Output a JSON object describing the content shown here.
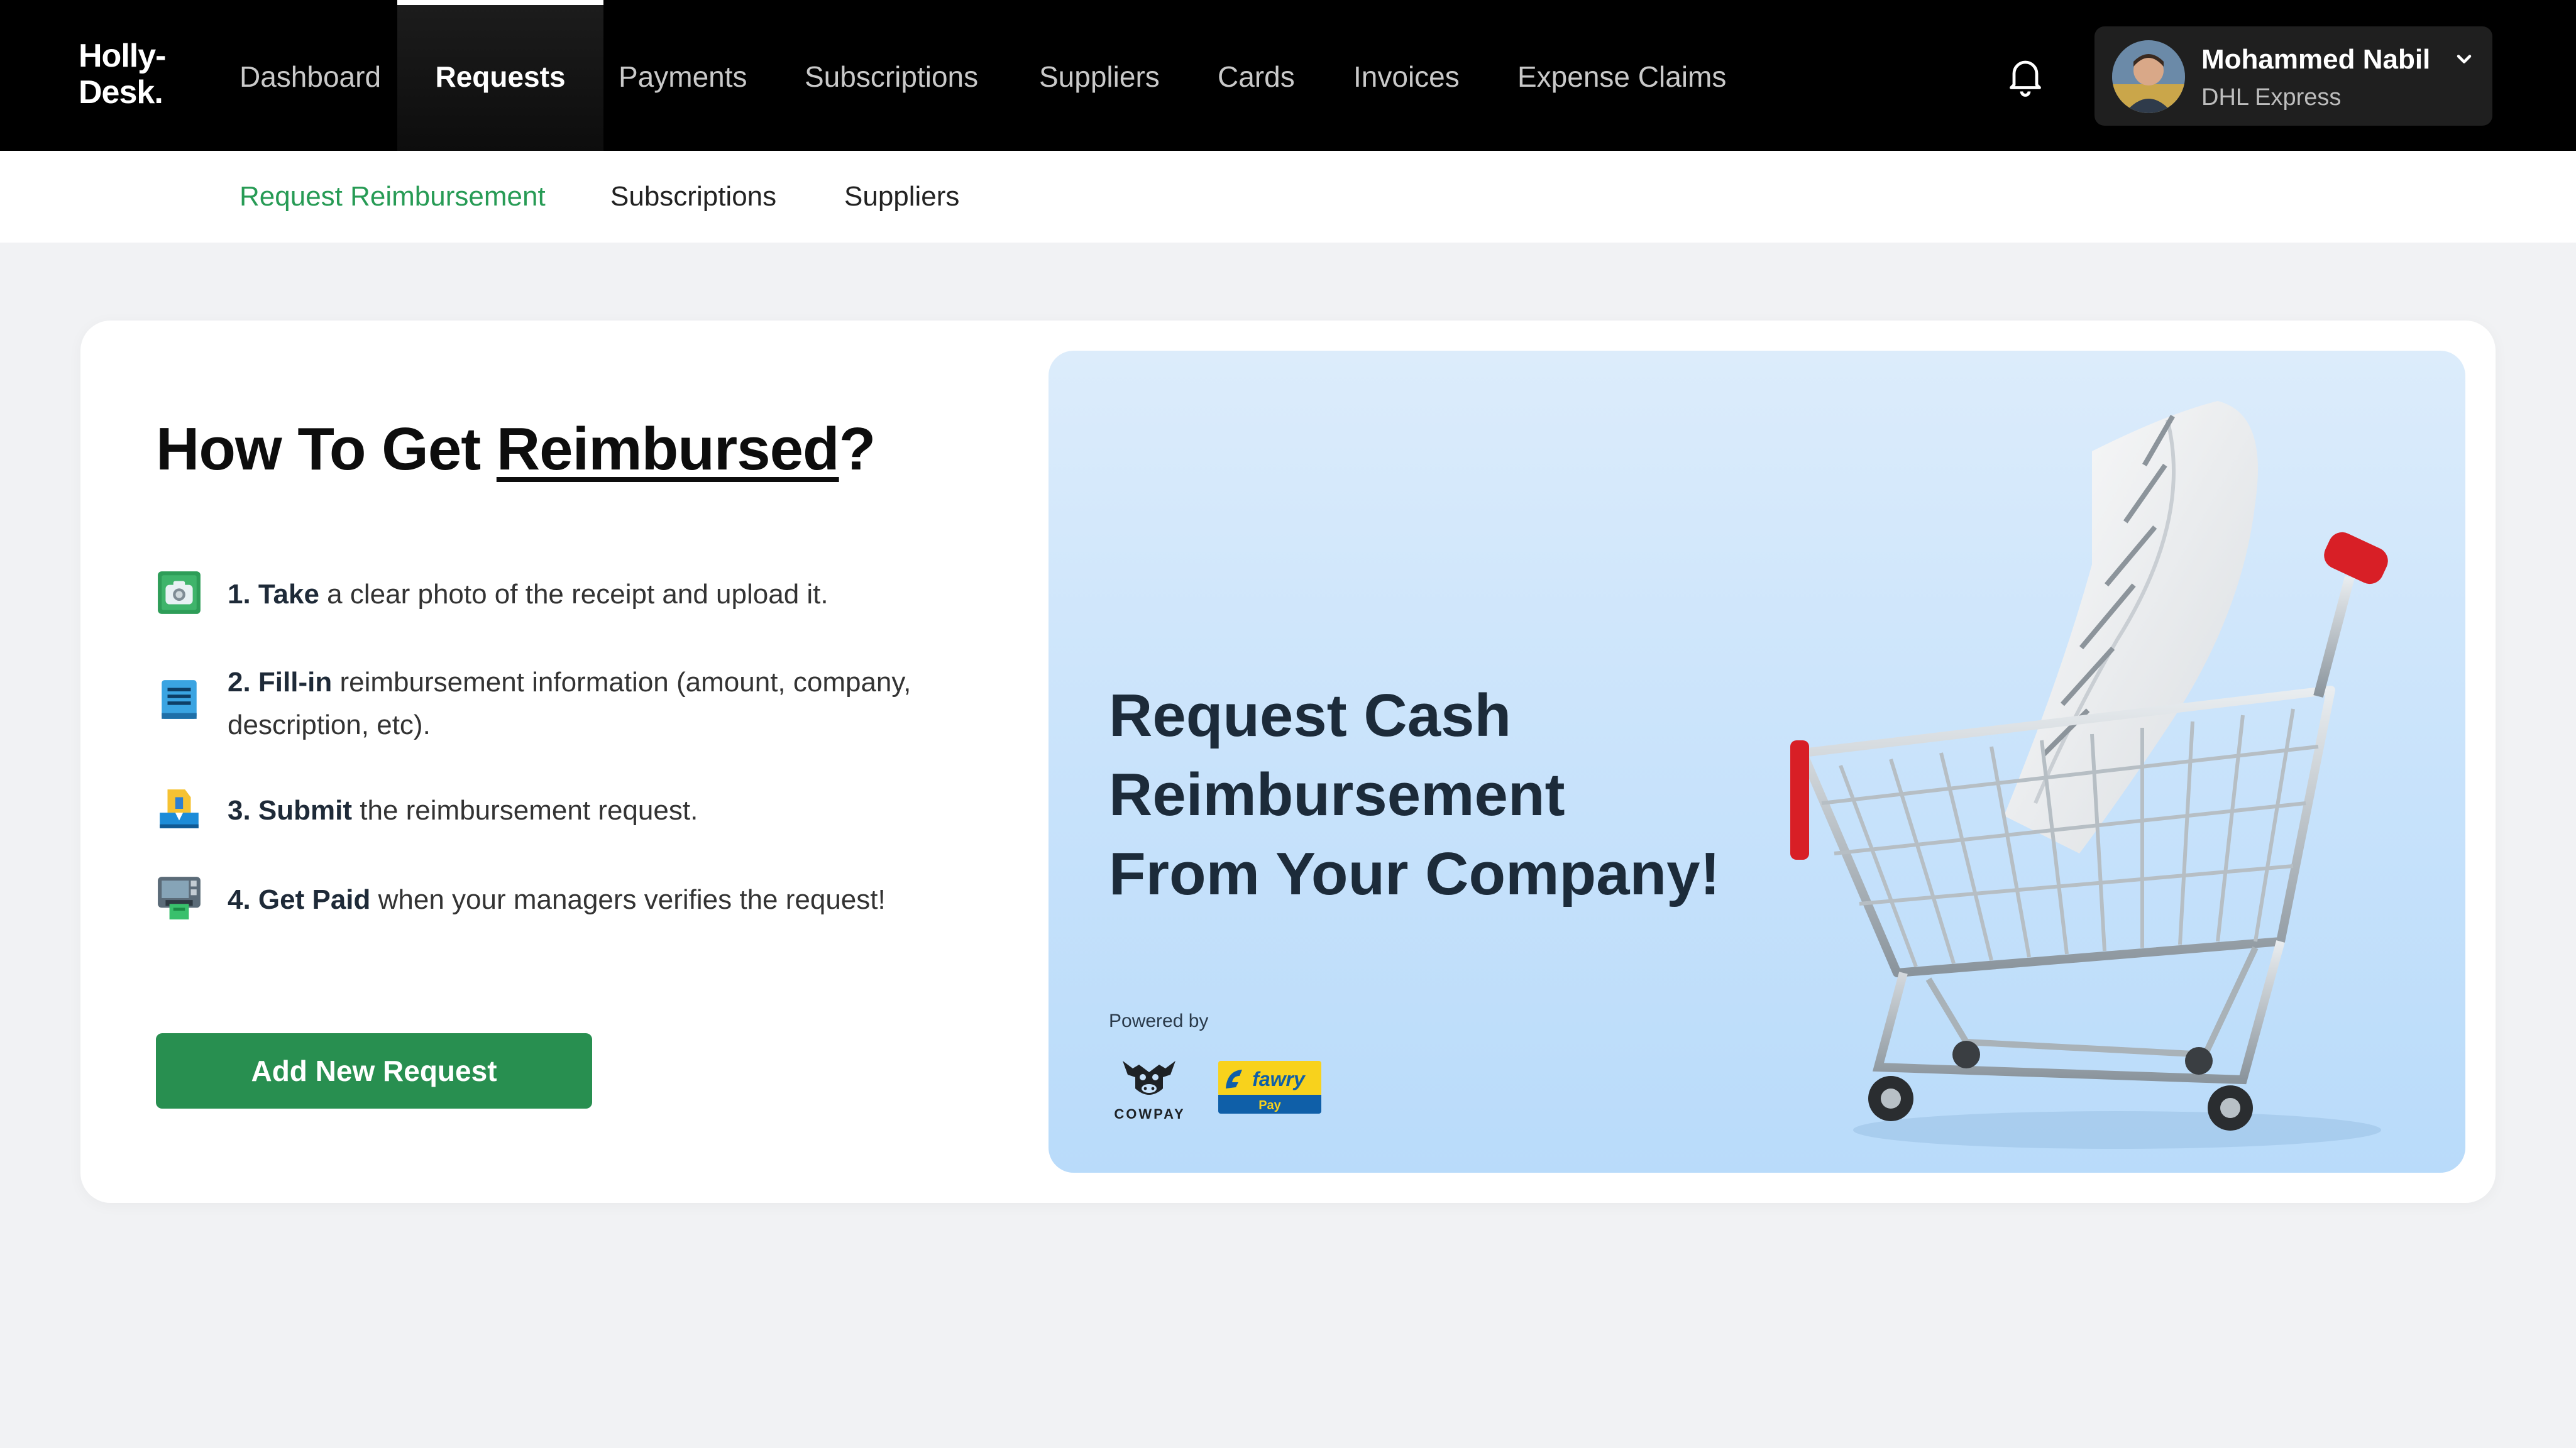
{
  "app": {
    "logo_line1": "Holly-",
    "logo_line2": "Desk."
  },
  "nav": {
    "items": [
      {
        "label": "Dashboard",
        "active": false
      },
      {
        "label": "Requests",
        "active": true
      },
      {
        "label": "Payments",
        "active": false
      },
      {
        "label": "Subscriptions",
        "active": false
      },
      {
        "label": "Suppliers",
        "active": false
      },
      {
        "label": "Cards",
        "active": false
      },
      {
        "label": "Invoices",
        "active": false
      },
      {
        "label": "Expense Claims",
        "active": false
      }
    ]
  },
  "user": {
    "name": "Mohammed Nabil",
    "company": "DHL Express"
  },
  "subnav": {
    "items": [
      {
        "label": "Request Reimbursement",
        "active": true
      },
      {
        "label": "Subscriptions",
        "active": false
      },
      {
        "label": "Suppliers",
        "active": false
      }
    ]
  },
  "guide": {
    "heading_prefix": "How To Get ",
    "heading_emphasis": "Reimbursed",
    "heading_suffix": "?",
    "steps": [
      {
        "icon": "camera-icon",
        "bold": "1. Take",
        "text": " a clear photo of the receipt and upload it."
      },
      {
        "icon": "document-icon",
        "bold": "2. Fill-in",
        "text": " reimbursement information (amount, company, description, etc)."
      },
      {
        "icon": "submit-icon",
        "bold": "3. Submit",
        "text": " the reimbursement request."
      },
      {
        "icon": "atm-cash-icon",
        "bold": "4. Get Paid",
        "text": " when your managers verifies the request!"
      }
    ],
    "add_button_label": "Add New Request"
  },
  "promo": {
    "title": "Request Cash\nReimbursement\nFrom Your Company!",
    "powered_by": "Powered by",
    "partner1": "COWPAY",
    "partner2_top": "fawry",
    "partner2_bottom": "Pay"
  },
  "colors": {
    "accent_green": "#279b55",
    "button_green": "#288f50",
    "topbar": "#000000",
    "promo_bg": "#c7e2fb"
  }
}
